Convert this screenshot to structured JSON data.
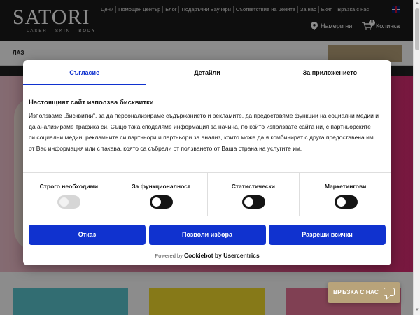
{
  "header": {
    "logo_text": "SATORI",
    "logo_subtitle": "LASER · SKIN · BODY",
    "top_links": [
      "Цени",
      "Помощен център",
      "Блог",
      "Подаръчни Ваучери",
      "Съответствие на цените",
      "За нас",
      "Екип",
      "Връзка с нас"
    ],
    "language_flag": "uk-flag-icon",
    "find_us": "Намери ни",
    "cart_label": "Количка",
    "cart_count": "0"
  },
  "nav": {
    "first_item": "ЛАЗ"
  },
  "cookie_dialog": {
    "tabs": [
      "Съгласие",
      "Детайли",
      "За приложението"
    ],
    "active_tab": "Съгласие",
    "title": "Настоящият сайт използва бисквитки",
    "body": "Използваме „бисквитки“, за да персонализираме съдържанието и рекламите, да предоставяме функции на социални медии и да анализираме трафика си. Също така споделяме информация за начина, по който използвате сайта ни, с партньорските си социални медии, рекламните си партньори и партньори за анализ, които може да я комбинират с друга предоставена им от Вас информация или с такава, която са събрали от ползването от Ваша страна на услугите им.",
    "toggles": [
      {
        "label": "Строго необходими",
        "state": "on-disabled"
      },
      {
        "label": "За функционалност",
        "state": "off"
      },
      {
        "label": "Статистически",
        "state": "off"
      },
      {
        "label": "Маркетингови",
        "state": "off"
      }
    ],
    "buttons": {
      "deny": "Отказ",
      "allow_selection": "Позволи избора",
      "allow_all": "Разреши всички"
    },
    "powered_prefix": "Powered by",
    "powered_brand": "Cookiebot by Usercentrics"
  },
  "contact": {
    "label": "ВРЪЗКА С НАС",
    "icon": "chat-icon"
  },
  "colors": {
    "accent_blue": "#1032cf",
    "gold": "#b8a37a",
    "header_bg": "#1a1a1a"
  }
}
